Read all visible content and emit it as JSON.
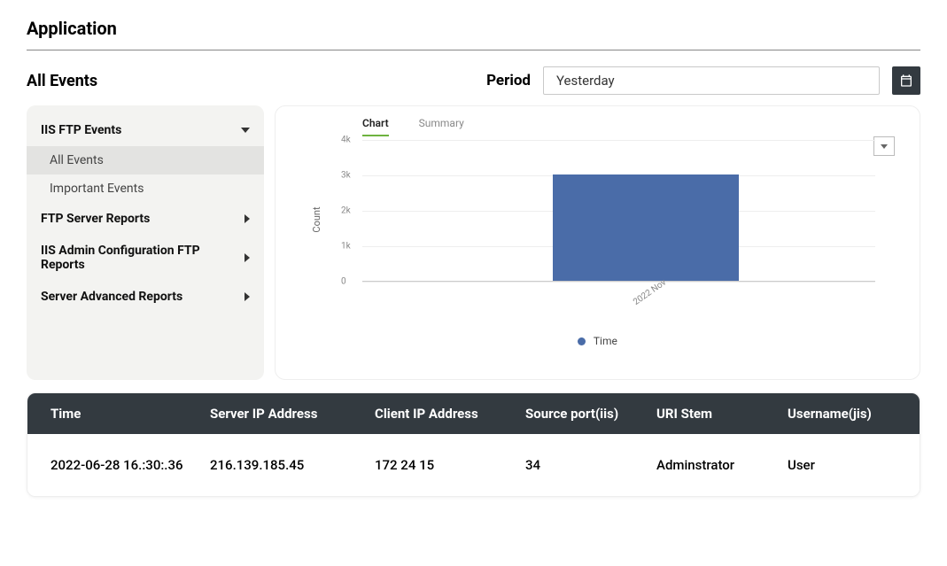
{
  "page_title": "Application",
  "section_title": "All Events",
  "period": {
    "label": "Period",
    "selected": "Yesterday"
  },
  "sidebar": {
    "groups": [
      {
        "label": "IIS FTP Events",
        "expanded": true,
        "items": [
          {
            "label": "All Events",
            "active": true
          },
          {
            "label": "Important Events",
            "active": false
          }
        ]
      },
      {
        "label": "FTP Server Reports",
        "expanded": false
      },
      {
        "label": "IIS Admin Configuration FTP Reports",
        "expanded": false
      },
      {
        "label": "Server Advanced Reports",
        "expanded": false
      }
    ]
  },
  "chart": {
    "tabs": [
      {
        "label": "Chart",
        "active": true
      },
      {
        "label": "Summary",
        "active": false
      }
    ],
    "legend": "Time"
  },
  "chart_data": {
    "type": "bar",
    "categories": [
      "2022 Nov"
    ],
    "values": [
      3000
    ],
    "title": "",
    "xlabel": "",
    "ylabel": "Count",
    "ylim": [
      0,
      4000
    ],
    "yticks": [
      0,
      1000,
      2000,
      3000,
      4000
    ],
    "ytick_labels": [
      "0",
      "1k",
      "2k",
      "3k",
      "4k"
    ]
  },
  "table": {
    "columns": [
      {
        "key": "time",
        "label": "Time"
      },
      {
        "key": "server_ip",
        "label": "Server IP Address"
      },
      {
        "key": "client_ip",
        "label": "Client IP Address"
      },
      {
        "key": "src_port",
        "label": "Source port(iis)"
      },
      {
        "key": "uri_stem",
        "label": "URI Stem"
      },
      {
        "key": "username",
        "label": "Username(jis)"
      }
    ],
    "rows": [
      {
        "time": "2022-06-28 16.:30:.36",
        "server_ip": "216.139.185.45",
        "client_ip": "172 24 15",
        "src_port": "34",
        "uri_stem": "Adminstrator",
        "username": "User"
      }
    ]
  }
}
